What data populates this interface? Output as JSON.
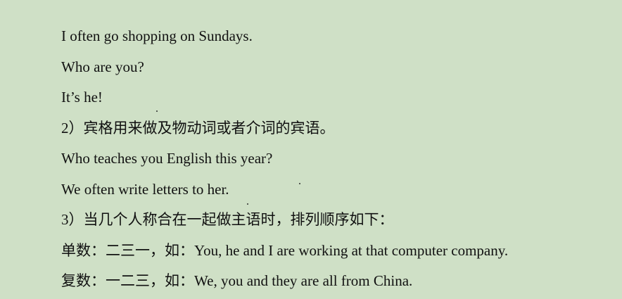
{
  "lines": [
    "I often go shopping on Sundays.",
    "Who are you?",
    "It’s he!",
    "2）宾格用来做及物动词或者介词的宾语。",
    "Who teaches you English this year?",
    "We often write letters to her.",
    "3）当几个人称合在一起做主语时，排列顺序如下：",
    "单数：二三一，如：You, he and I are working at that computer company.",
    "复数：一二三，如：We, you and they are all from China."
  ],
  "background_color": "#cfe0c6",
  "text_color": "#111111"
}
